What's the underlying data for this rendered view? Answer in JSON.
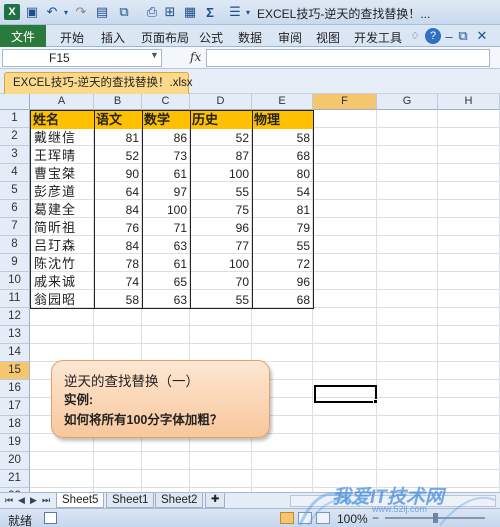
{
  "window": {
    "title": "EXCEL技巧-逆天的查找替换！..."
  },
  "ribbon": {
    "file_tab": "文件",
    "tabs": [
      "开始",
      "插入",
      "页面布局",
      "公式",
      "数据",
      "审阅",
      "视图",
      "开发工具"
    ]
  },
  "formula_bar": {
    "name_box": "F15",
    "fx": "fx",
    "formula": ""
  },
  "workbook_tab": "EXCEL技巧-逆天的查找替换！.xlsx",
  "columns": [
    "A",
    "B",
    "C",
    "D",
    "E",
    "F",
    "G",
    "H"
  ],
  "rows": [
    "1",
    "2",
    "3",
    "4",
    "5",
    "6",
    "7",
    "8",
    "9",
    "10",
    "11",
    "12",
    "13",
    "14",
    "15",
    "16",
    "17",
    "18",
    "19",
    "20",
    "21",
    "22"
  ],
  "table": {
    "headers": [
      "姓名",
      "语文",
      "数学",
      "历史",
      "物理"
    ],
    "data": [
      [
        "戴继信",
        "81",
        "86",
        "52",
        "58"
      ],
      [
        "王珲晴",
        "52",
        "73",
        "87",
        "68"
      ],
      [
        "曹宝桀",
        "90",
        "61",
        "100",
        "80"
      ],
      [
        "彭彦道",
        "64",
        "97",
        "55",
        "54"
      ],
      [
        "葛建全",
        "84",
        "100",
        "75",
        "81"
      ],
      [
        "简昕祖",
        "76",
        "71",
        "96",
        "79"
      ],
      [
        "吕玎森",
        "84",
        "63",
        "77",
        "55"
      ],
      [
        "陈沈竹",
        "78",
        "61",
        "100",
        "72"
      ],
      [
        "戚来诚",
        "74",
        "65",
        "70",
        "96"
      ],
      [
        "翁园昭",
        "58",
        "63",
        "55",
        "68"
      ]
    ]
  },
  "callout": {
    "line1": "逆天的查找替换（一）",
    "line2": "实例:",
    "line3": "如何将所有100分字体加粗？"
  },
  "sheets": [
    "Sheet5",
    "Sheet1",
    "Sheet2"
  ],
  "status": {
    "ready": "就绪",
    "zoom": "100%"
  },
  "watermark": {
    "text": "我爱IT技术网",
    "url": "www.52ij.com"
  }
}
